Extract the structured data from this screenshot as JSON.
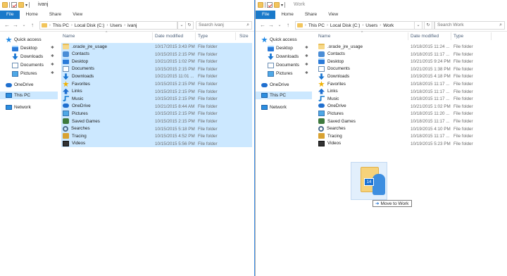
{
  "left": {
    "title": "ivanj",
    "ribbon": [
      "File",
      "Home",
      "Share",
      "View"
    ],
    "breadcrumb": [
      "This PC",
      "Local Disk (C:)",
      "Users",
      "ivanj"
    ],
    "search_placeholder": "Search ivanj",
    "columns": {
      "name": "Name",
      "date": "Date modified",
      "type": "Type",
      "size": "Size"
    },
    "nav": [
      {
        "label": "Quick access",
        "icon": "star-icon"
      },
      {
        "label": "Desktop",
        "icon": "desktop-icon",
        "pinned": true
      },
      {
        "label": "Downloads",
        "icon": "downloads-icon",
        "pinned": true
      },
      {
        "label": "Documents",
        "icon": "documents-icon",
        "pinned": true
      },
      {
        "label": "Pictures",
        "icon": "pictures-icon",
        "pinned": true
      },
      {
        "label": "OneDrive",
        "icon": "onedrive-icon"
      },
      {
        "label": "This PC",
        "icon": "this-pc-icon"
      },
      {
        "label": "Network",
        "icon": "network-icon"
      }
    ],
    "files": [
      {
        "name": ".oracle_jre_usage",
        "date": "10/17/2015 3:43 PM",
        "type": "File folder",
        "icon": "folder-icon"
      },
      {
        "name": "Contacts",
        "date": "10/15/2015 2:15 PM",
        "type": "File folder",
        "icon": "contacts-icon"
      },
      {
        "name": "Desktop",
        "date": "10/21/2015 1:02 PM",
        "type": "File folder",
        "icon": "desktop-icon"
      },
      {
        "name": "Documents",
        "date": "10/15/2015 2:15 PM",
        "type": "File folder",
        "icon": "documents-icon"
      },
      {
        "name": "Downloads",
        "date": "10/21/2015 11:01 ...",
        "type": "File folder",
        "icon": "downloads-icon"
      },
      {
        "name": "Favorites",
        "date": "10/15/2015 2:15 PM",
        "type": "File folder",
        "icon": "favorites-icon"
      },
      {
        "name": "Links",
        "date": "10/15/2015 2:15 PM",
        "type": "File folder",
        "icon": "links-icon"
      },
      {
        "name": "Music",
        "date": "10/15/2015 2:15 PM",
        "type": "File folder",
        "icon": "music-icon"
      },
      {
        "name": "OneDrive",
        "date": "10/21/2015 8:44 AM",
        "type": "File folder",
        "icon": "onedrive-icon"
      },
      {
        "name": "Pictures",
        "date": "10/15/2015 2:15 PM",
        "type": "File folder",
        "icon": "pictures-icon"
      },
      {
        "name": "Saved Games",
        "date": "10/15/2015 2:15 PM",
        "type": "File folder",
        "icon": "saved-games-icon"
      },
      {
        "name": "Searches",
        "date": "10/15/2015 5:18 PM",
        "type": "File folder",
        "icon": "searches-icon"
      },
      {
        "name": "Tracing",
        "date": "10/15/2015 4:52 PM",
        "type": "File folder",
        "icon": "tracing-icon"
      },
      {
        "name": "Videos",
        "date": "10/15/2015 5:56 PM",
        "type": "File folder",
        "icon": "videos-icon"
      }
    ]
  },
  "right": {
    "title": "Work",
    "ribbon": [
      "File",
      "Home",
      "Share",
      "View"
    ],
    "breadcrumb": [
      "This PC",
      "Local Disk (C:)",
      "Users",
      "Work"
    ],
    "search_placeholder": "Search Work",
    "columns": {
      "name": "Name",
      "date": "Date modified",
      "type": "Type"
    },
    "nav": [
      {
        "label": "Quick access",
        "icon": "star-icon"
      },
      {
        "label": "Desktop",
        "icon": "desktop-icon",
        "pinned": true
      },
      {
        "label": "Downloads",
        "icon": "downloads-icon",
        "pinned": true
      },
      {
        "label": "Documents",
        "icon": "documents-icon",
        "pinned": true
      },
      {
        "label": "Pictures",
        "icon": "pictures-icon",
        "pinned": true
      },
      {
        "label": "OneDrive",
        "icon": "onedrive-icon"
      },
      {
        "label": "This PC",
        "icon": "this-pc-icon"
      },
      {
        "label": "Network",
        "icon": "network-icon"
      }
    ],
    "files": [
      {
        "name": ".oracle_jre_usage",
        "date": "10/18/2015 11:24 ...",
        "type": "File folder",
        "icon": "folder-icon"
      },
      {
        "name": "Contacts",
        "date": "10/18/2015 11:17 ...",
        "type": "File folder",
        "icon": "contacts-icon"
      },
      {
        "name": "Desktop",
        "date": "10/21/2015 9:24 PM",
        "type": "File folder",
        "icon": "desktop-icon"
      },
      {
        "name": "Documents",
        "date": "10/21/2015 1:38 PM",
        "type": "File folder",
        "icon": "documents-icon"
      },
      {
        "name": "Downloads",
        "date": "10/19/2015 4:18 PM",
        "type": "File folder",
        "icon": "downloads-icon"
      },
      {
        "name": "Favorites",
        "date": "10/18/2015 11:17 ...",
        "type": "File folder",
        "icon": "favorites-icon"
      },
      {
        "name": "Links",
        "date": "10/18/2015 11:17 ...",
        "type": "File folder",
        "icon": "links-icon"
      },
      {
        "name": "Music",
        "date": "10/18/2015 11:17 ...",
        "type": "File folder",
        "icon": "music-icon"
      },
      {
        "name": "OneDrive",
        "date": "10/21/2015 1:02 PM",
        "type": "File folder",
        "icon": "onedrive-icon"
      },
      {
        "name": "Pictures",
        "date": "10/18/2015 11:20 ...",
        "type": "File folder",
        "icon": "pictures-icon"
      },
      {
        "name": "Saved Games",
        "date": "10/18/2015 11:17 ...",
        "type": "File folder",
        "icon": "saved-games-icon"
      },
      {
        "name": "Searches",
        "date": "10/19/2015 4:10 PM",
        "type": "File folder",
        "icon": "searches-icon"
      },
      {
        "name": "Tracing",
        "date": "10/18/2015 11:17 ...",
        "type": "File folder",
        "icon": "tracing-icon"
      },
      {
        "name": "Videos",
        "date": "10/19/2015 5:23 PM",
        "type": "File folder",
        "icon": "videos-icon"
      }
    ]
  },
  "drag": {
    "count": "14",
    "tooltip": "Move to Work"
  },
  "colors": {
    "accent": "#1979ca",
    "selection": "#cce8ff",
    "folder": "#f2c55c"
  }
}
